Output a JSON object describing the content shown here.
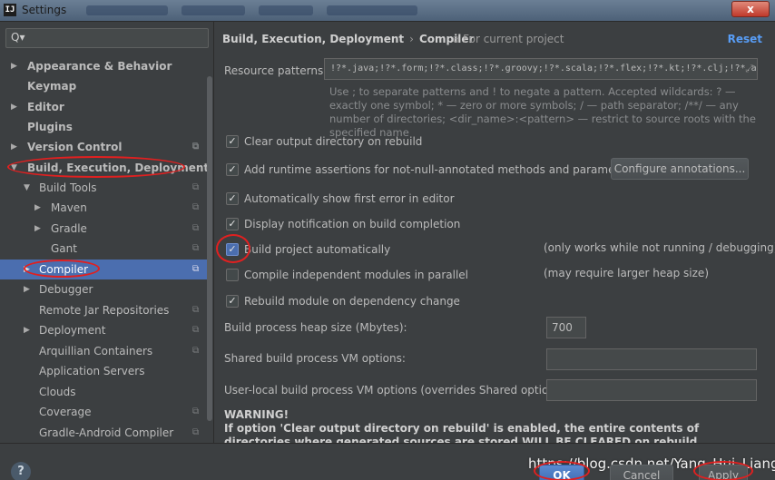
{
  "window": {
    "title": "Settings",
    "app_icon": "IJ",
    "close": "x"
  },
  "sidebar": {
    "search_placeholder": "Q▾",
    "items": [
      {
        "label": "Appearance & Behavior",
        "arrow": "▶"
      },
      {
        "label": "Keymap",
        "arrow": ""
      },
      {
        "label": "Editor",
        "arrow": "▶"
      },
      {
        "label": "Plugins",
        "arrow": ""
      },
      {
        "label": "Version Control",
        "arrow": "▶"
      },
      {
        "label": "Build, Execution, Deployment",
        "arrow": "▼"
      },
      {
        "label": "Build Tools",
        "arrow": "▼"
      },
      {
        "label": "Maven",
        "arrow": "▶"
      },
      {
        "label": "Gradle",
        "arrow": "▶"
      },
      {
        "label": "Gant",
        "arrow": ""
      },
      {
        "label": "Compiler",
        "arrow": "▶"
      },
      {
        "label": "Debugger",
        "arrow": "▶"
      },
      {
        "label": "Remote Jar Repositories",
        "arrow": ""
      },
      {
        "label": "Deployment",
        "arrow": "▶"
      },
      {
        "label": "Arquillian Containers",
        "arrow": ""
      },
      {
        "label": "Application Servers",
        "arrow": ""
      },
      {
        "label": "Clouds",
        "arrow": ""
      },
      {
        "label": "Coverage",
        "arrow": ""
      },
      {
        "label": "Gradle-Android Compiler",
        "arrow": ""
      }
    ],
    "project_glyph": "⧉"
  },
  "main": {
    "breadcrumb_parent": "Build, Execution, Deployment",
    "breadcrumb_sep": "›",
    "breadcrumb_current": "Compiler",
    "for_project": "For current project",
    "reset": "Reset",
    "resource_patterns_label": "Resource patterns:",
    "resource_patterns_value": "!?*.java;!?*.form;!?*.class;!?*.groovy;!?*.scala;!?*.flex;!?*.kt;!?*.clj;!?*.aj",
    "help_text": "Use ; to separate patterns and ! to negate a pattern. Accepted wildcards: ? — exactly one symbol; * — zero or more symbols; / — path separator; /**/ — any number of directories; <dir_name>:<pattern> — restrict to source roots with the specified name",
    "checkboxes": [
      {
        "label": "Clear output directory on rebuild",
        "checked": "✓"
      },
      {
        "label": "Add runtime assertions for not-null-annotated methods and parameters",
        "checked": "✓"
      },
      {
        "label": "Automatically show first error in editor",
        "checked": "✓"
      },
      {
        "label": "Display notification on build completion",
        "checked": "✓"
      },
      {
        "label": "Build project automatically",
        "checked": "✓"
      },
      {
        "label": "Compile independent modules in parallel",
        "checked": ""
      },
      {
        "label": "Rebuild module on dependency change",
        "checked": "✓"
      }
    ],
    "configure_annotations": "Configure annotations...",
    "note_build_auto": "(only works while not running / debugging)",
    "note_parallel": "(may require larger heap size)",
    "heap_label": "Build process heap size (Mbytes):",
    "heap_value": "700",
    "shared_vm_label": "Shared build process VM options:",
    "shared_vm_value": "",
    "user_vm_label": "User-local build process VM options (overrides Shared options):",
    "user_vm_value": "",
    "warning_title": "WARNING!",
    "warning_text": "If option 'Clear output directory on rebuild' is enabled, the entire contents of directories where generated sources are stored WILL BE CLEARED on rebuild."
  },
  "footer": {
    "help": "?",
    "ok": "OK",
    "cancel": "Cancel",
    "apply": "Apply",
    "watermark": "https://blog.csdn.net/Yang_Hui_Liang"
  },
  "colors": {
    "background": "#3c3f41",
    "selection": "#4b6eaf",
    "link": "#589df6",
    "annotation": "#e02020"
  }
}
